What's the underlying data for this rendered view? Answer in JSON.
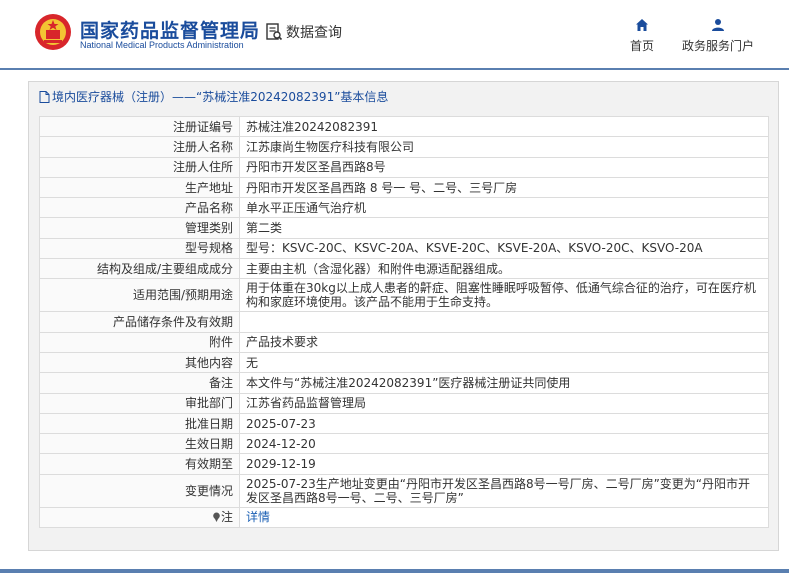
{
  "header": {
    "logo_cn": "国家药品监督管理局",
    "logo_en": "National Medical Products Administration",
    "search_tab": "数据查询",
    "nav_home": "首页",
    "nav_portal": "政务服务门户",
    "icons": {
      "logo": "emblem-icon",
      "search": "document-search-icon",
      "home": "home-icon",
      "portal": "user-icon"
    },
    "brand_color": "#1a4c9c"
  },
  "panel": {
    "title": "境内医疗器械（注册）——“苏械注准20242082391”基本信息"
  },
  "rows": [
    {
      "label": "注册证编号",
      "value": "苏械注准20242082391"
    },
    {
      "label": "注册人名称",
      "value": "江苏康尚生物医疗科技有限公司"
    },
    {
      "label": "注册人住所",
      "value": "丹阳市开发区圣昌西路8号"
    },
    {
      "label": "生产地址",
      "value": "丹阳市开发区圣昌西路 8 号一 号、二号、三号厂房"
    },
    {
      "label": "产品名称",
      "value": "单水平正压通气治疗机"
    },
    {
      "label": "管理类别",
      "value": "第二类"
    },
    {
      "label": "型号规格",
      "value": "型号：KSVC-20C、KSVC-20A、KSVE-20C、KSVE-20A、KSVO-20C、KSVO-20A"
    },
    {
      "label": "结构及组成/主要组成成分",
      "value": "主要由主机（含湿化器）和附件电源适配器组成。"
    },
    {
      "label": "适用范围/预期用途",
      "value": "用于体重在30kg以上成人患者的鼾症、阻塞性睡眠呼吸暂停、低通气综合征的治疗，可在医疗机构和家庭环境使用。该产品不能用于生命支持。"
    },
    {
      "label": "产品储存条件及有效期",
      "value": ""
    },
    {
      "label": "附件",
      "value": "产品技术要求"
    },
    {
      "label": "其他内容",
      "value": "无"
    },
    {
      "label": "备注",
      "value": "本文件与“苏械注准20242082391”医疗器械注册证共同使用"
    },
    {
      "label": "审批部门",
      "value": "江苏省药品监督管理局"
    },
    {
      "label": "批准日期",
      "value": "2025-07-23"
    },
    {
      "label": "生效日期",
      "value": "2024-12-20"
    },
    {
      "label": "有效期至",
      "value": "2029-12-19"
    },
    {
      "label": "变更情况",
      "value": "2025-07-23生产地址变更由“丹阳市开发区圣昌西路8号一号厂房、二号厂房”变更为“丹阳市开发区圣昌西路8号一号、二号、三号厂房”"
    },
    {
      "label": "注",
      "value": "详情"
    }
  ]
}
